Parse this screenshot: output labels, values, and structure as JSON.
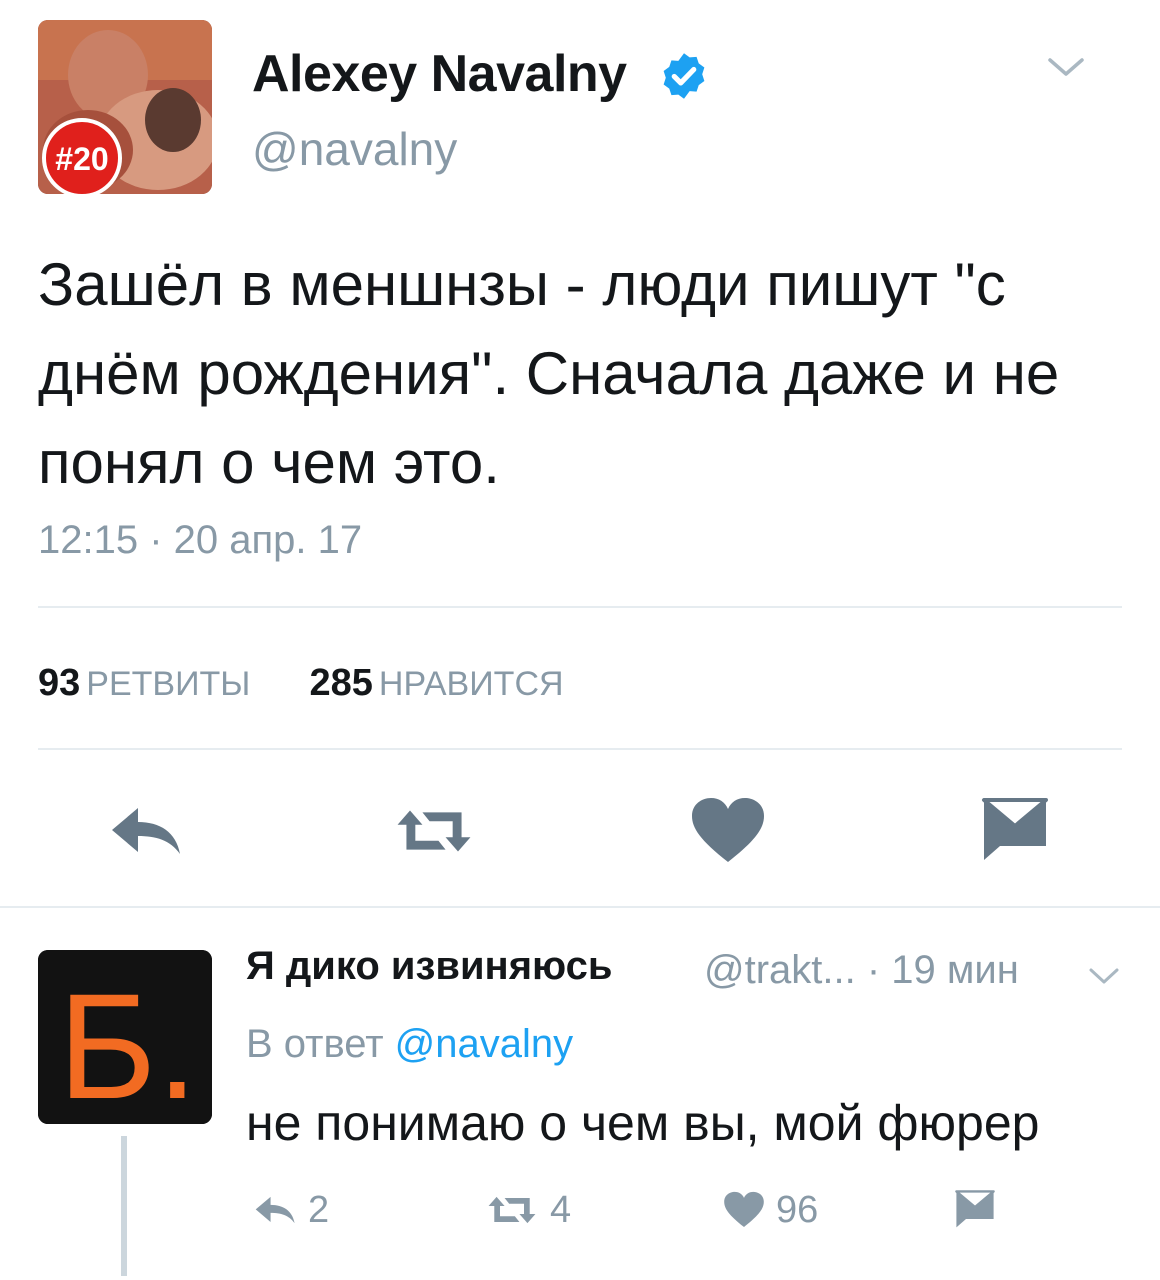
{
  "tweet": {
    "author_name": "Alexey Navalny",
    "author_handle": "@navalny",
    "avatar_badge": "#20",
    "text": "Зашёл в меншнзы - люди пишут \"с днём рождения\". Сначала даже и не понял о чем это.",
    "timestamp": "12:15 · 20 апр. 17",
    "stats": {
      "retweets_count": "93",
      "retweets_label": "РЕТВИТЫ",
      "likes_count": "285",
      "likes_label": "НРАВИТСЯ"
    },
    "icons": [
      "verified-icon",
      "chevron-down-icon",
      "reply-icon",
      "retweet-icon",
      "heart-icon",
      "dm-icon"
    ]
  },
  "reply": {
    "author_name": "Я дико извиняюсь",
    "author_handle_meta": "@trakt... · 19 мин",
    "avatar_letter": "Б.",
    "in_reply_prefix": "В ответ",
    "in_reply_mention": "@navalny",
    "text": "не понимаю о чем вы, мой фюрер",
    "reply_count": "2",
    "retweet_count": "4",
    "like_count": "96"
  },
  "colors": {
    "text": "#14171a",
    "muted": "#8899a6",
    "action_icon": "#657786",
    "verified": "#1da1f2",
    "link": "#1da1f2",
    "divider": "#e6ecf0",
    "badge_red": "#e0201c",
    "reply_avatar_orange": "#f26b22"
  }
}
